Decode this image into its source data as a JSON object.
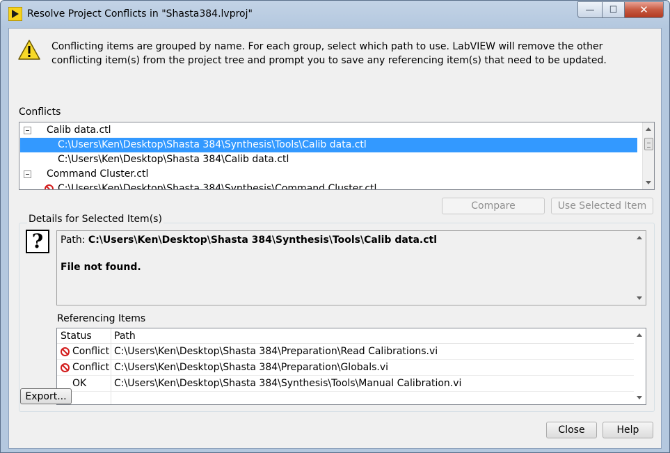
{
  "window": {
    "title": "Resolve Project Conflicts in \"Shasta384.lvproj\"",
    "minimize_glyph": "—",
    "maximize_glyph": "☐",
    "close_glyph": "✕"
  },
  "intro_text": "Conflicting items are grouped by name.  For each group, select which path to use.  LabVIEW will remove the other conflicting item(s) from the project tree and prompt you to save any referencing item(s) that need to be updated.",
  "conflicts": {
    "label": "Conflicts",
    "rows": [
      {
        "text": "Calib data.ctl",
        "kind": "group"
      },
      {
        "text": "C:\\Users\\Ken\\Desktop\\Shasta 384\\Synthesis\\Tools\\Calib data.ctl",
        "kind": "path",
        "selected": true
      },
      {
        "text": "C:\\Users\\Ken\\Desktop\\Shasta 384\\Calib data.ctl",
        "kind": "path"
      },
      {
        "text": "Command Cluster.ctl",
        "kind": "group"
      },
      {
        "text": "C:\\Users\\Ken\\Desktop\\Shasta 384\\Synthesis\\Command Cluster.ctl",
        "kind": "path",
        "icon": "no-entry-icon"
      }
    ]
  },
  "buttons": {
    "compare": "Compare",
    "use_selected": "Use Selected Item",
    "export": "Export...",
    "close": "Close",
    "help": "Help"
  },
  "details": {
    "label": "Details for Selected Item(s)",
    "path_prefix": "Path: ",
    "path_value": "C:\\Users\\Ken\\Desktop\\Shasta 384\\Synthesis\\Tools\\Calib data.ctl",
    "status_message": "File not found.",
    "help_glyph": "?"
  },
  "referencing": {
    "label": "Referencing Items",
    "columns": [
      "Status",
      "Path"
    ],
    "rows": [
      {
        "status": "Conflict",
        "path": "C:\\Users\\Ken\\Desktop\\Shasta 384\\Preparation\\Read Calibrations.vi",
        "icon": "no-entry-icon"
      },
      {
        "status": "Conflict",
        "path": "C:\\Users\\Ken\\Desktop\\Shasta 384\\Preparation\\Globals.vi",
        "icon": "no-entry-icon"
      },
      {
        "status": "OK",
        "path": "C:\\Users\\Ken\\Desktop\\Shasta 384\\Synthesis\\Tools\\Manual Calibration.vi"
      }
    ]
  },
  "colors": {
    "selection": "#3399ff",
    "conflict_icon": "#d21b1b"
  }
}
